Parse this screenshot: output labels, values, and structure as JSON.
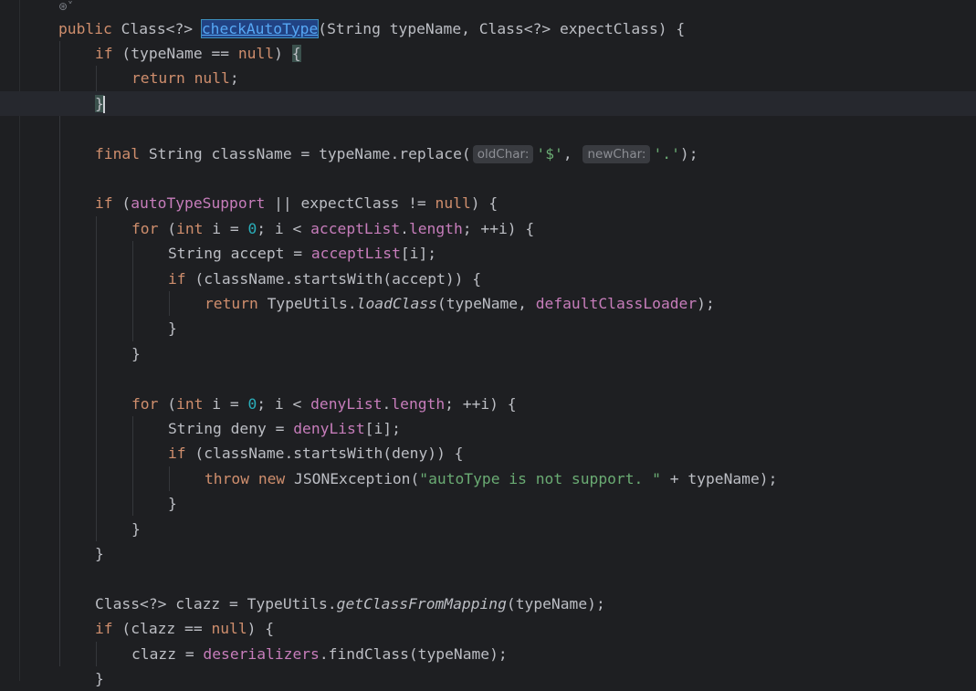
{
  "editor": {
    "fold_icon": "⊛˅",
    "lines": [
      {
        "indent": 0,
        "tokens": [
          {
            "t": "public ",
            "c": "kw"
          },
          {
            "t": "Class<?> ",
            "c": "plain"
          },
          {
            "t": "checkAutoType",
            "c": "hl-method"
          },
          {
            "t": "(String typeName, Class<?> expectClass) {",
            "c": "plain"
          }
        ]
      },
      {
        "indent": 1,
        "tokens": [
          {
            "t": "if ",
            "c": "kw"
          },
          {
            "t": "(typeName == ",
            "c": "plain"
          },
          {
            "t": "null",
            "c": "kw"
          },
          {
            "t": ") ",
            "c": "plain"
          },
          {
            "t": "{",
            "c": "brace-hl"
          }
        ]
      },
      {
        "indent": 2,
        "tokens": [
          {
            "t": "return ",
            "c": "kw"
          },
          {
            "t": "null",
            "c": "kw"
          },
          {
            "t": ";",
            "c": "plain"
          }
        ]
      },
      {
        "indent": 1,
        "current": true,
        "tokens": [
          {
            "t": "}",
            "c": "brace-hl"
          },
          {
            "t": "",
            "c": "caret"
          }
        ]
      },
      {
        "indent": 0,
        "tokens": []
      },
      {
        "indent": 1,
        "tokens": [
          {
            "t": "final ",
            "c": "kw"
          },
          {
            "t": "String className = typeName.replace(",
            "c": "plain"
          },
          {
            "t": "oldChar:",
            "c": "hint"
          },
          {
            "t": "'$'",
            "c": "str"
          },
          {
            "t": ", ",
            "c": "plain"
          },
          {
            "t": "newChar:",
            "c": "hint"
          },
          {
            "t": "'.'",
            "c": "str"
          },
          {
            "t": ");",
            "c": "plain"
          }
        ]
      },
      {
        "indent": 0,
        "tokens": []
      },
      {
        "indent": 1,
        "tokens": [
          {
            "t": "if ",
            "c": "kw"
          },
          {
            "t": "(",
            "c": "plain"
          },
          {
            "t": "autoTypeSupport",
            "c": "fld"
          },
          {
            "t": " || expectClass != ",
            "c": "plain"
          },
          {
            "t": "null",
            "c": "kw"
          },
          {
            "t": ") {",
            "c": "plain"
          }
        ]
      },
      {
        "indent": 2,
        "tokens": [
          {
            "t": "for ",
            "c": "kw"
          },
          {
            "t": "(",
            "c": "plain"
          },
          {
            "t": "int ",
            "c": "kw"
          },
          {
            "t": "i = ",
            "c": "plain"
          },
          {
            "t": "0",
            "c": "num"
          },
          {
            "t": "; i < ",
            "c": "plain"
          },
          {
            "t": "acceptList",
            "c": "fld"
          },
          {
            "t": ".",
            "c": "plain"
          },
          {
            "t": "length",
            "c": "fld"
          },
          {
            "t": "; ++i) {",
            "c": "plain"
          }
        ]
      },
      {
        "indent": 3,
        "tokens": [
          {
            "t": "String accept = ",
            "c": "plain"
          },
          {
            "t": "acceptList",
            "c": "fld"
          },
          {
            "t": "[i];",
            "c": "plain"
          }
        ]
      },
      {
        "indent": 3,
        "tokens": [
          {
            "t": "if ",
            "c": "kw"
          },
          {
            "t": "(className.startsWith(accept)) {",
            "c": "plain"
          }
        ]
      },
      {
        "indent": 4,
        "tokens": [
          {
            "t": "return ",
            "c": "kw"
          },
          {
            "t": "TypeUtils.",
            "c": "plain"
          },
          {
            "t": "loadClass",
            "c": "it"
          },
          {
            "t": "(typeName, ",
            "c": "plain"
          },
          {
            "t": "defaultClassLoader",
            "c": "fld"
          },
          {
            "t": ");",
            "c": "plain"
          }
        ]
      },
      {
        "indent": 3,
        "tokens": [
          {
            "t": "}",
            "c": "plain"
          }
        ]
      },
      {
        "indent": 2,
        "tokens": [
          {
            "t": "}",
            "c": "plain"
          }
        ]
      },
      {
        "indent": 0,
        "tokens": []
      },
      {
        "indent": 2,
        "tokens": [
          {
            "t": "for ",
            "c": "kw"
          },
          {
            "t": "(",
            "c": "plain"
          },
          {
            "t": "int ",
            "c": "kw"
          },
          {
            "t": "i = ",
            "c": "plain"
          },
          {
            "t": "0",
            "c": "num"
          },
          {
            "t": "; i < ",
            "c": "plain"
          },
          {
            "t": "denyList",
            "c": "fld"
          },
          {
            "t": ".",
            "c": "plain"
          },
          {
            "t": "length",
            "c": "fld"
          },
          {
            "t": "; ++i) {",
            "c": "plain"
          }
        ]
      },
      {
        "indent": 3,
        "tokens": [
          {
            "t": "String deny = ",
            "c": "plain"
          },
          {
            "t": "denyList",
            "c": "fld"
          },
          {
            "t": "[i];",
            "c": "plain"
          }
        ]
      },
      {
        "indent": 3,
        "tokens": [
          {
            "t": "if ",
            "c": "kw"
          },
          {
            "t": "(className.startsWith(deny)) {",
            "c": "plain"
          }
        ]
      },
      {
        "indent": 4,
        "tokens": [
          {
            "t": "throw ",
            "c": "kw"
          },
          {
            "t": "new ",
            "c": "kw"
          },
          {
            "t": "JSONException(",
            "c": "plain"
          },
          {
            "t": "\"autoType is not support. \"",
            "c": "str"
          },
          {
            "t": " + typeName);",
            "c": "plain"
          }
        ]
      },
      {
        "indent": 3,
        "tokens": [
          {
            "t": "}",
            "c": "plain"
          }
        ]
      },
      {
        "indent": 2,
        "tokens": [
          {
            "t": "}",
            "c": "plain"
          }
        ]
      },
      {
        "indent": 1,
        "tokens": [
          {
            "t": "}",
            "c": "plain"
          }
        ]
      },
      {
        "indent": 0,
        "tokens": []
      },
      {
        "indent": 1,
        "tokens": [
          {
            "t": "Class<?> clazz = TypeUtils.",
            "c": "plain"
          },
          {
            "t": "getClassFromMapping",
            "c": "it"
          },
          {
            "t": "(typeName);",
            "c": "plain"
          }
        ]
      },
      {
        "indent": 1,
        "tokens": [
          {
            "t": "if ",
            "c": "kw"
          },
          {
            "t": "(clazz == ",
            "c": "plain"
          },
          {
            "t": "null",
            "c": "kw"
          },
          {
            "t": ") {",
            "c": "plain"
          }
        ]
      },
      {
        "indent": 2,
        "tokens": [
          {
            "t": "clazz = ",
            "c": "plain"
          },
          {
            "t": "deserializers",
            "c": "fld"
          },
          {
            "t": ".findClass(typeName);",
            "c": "plain"
          }
        ]
      },
      {
        "indent": 1,
        "tokens": [
          {
            "t": "}",
            "c": "plain"
          }
        ]
      }
    ]
  }
}
